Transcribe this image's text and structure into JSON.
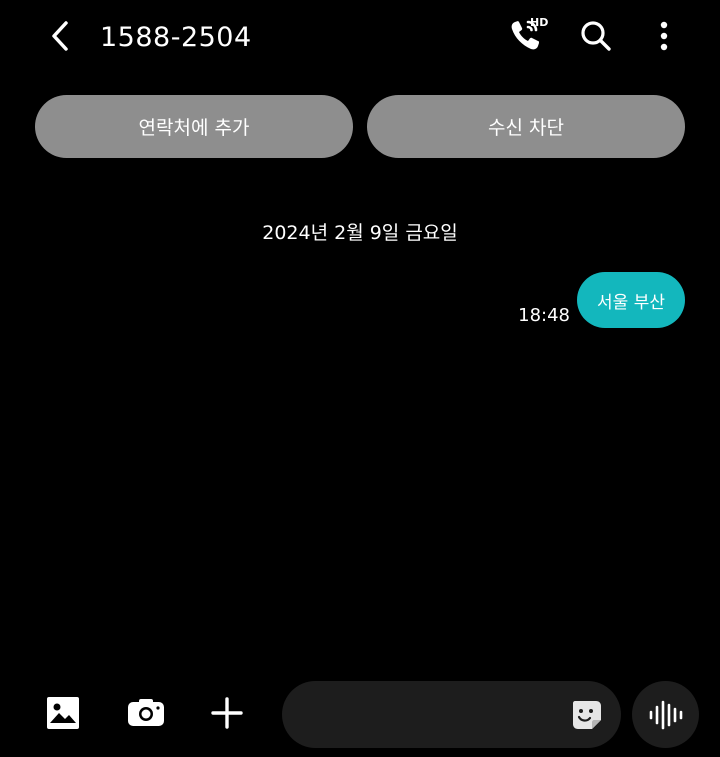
{
  "header": {
    "title": "1588-2504",
    "back_icon": "chevron-left-icon",
    "call_icon": "hd-call-icon",
    "call_badge": "HD",
    "search_icon": "search-icon",
    "more_icon": "more-vertical-icon"
  },
  "actions": {
    "add_contact": "연락처에 추가",
    "block_number": "수신 차단"
  },
  "conversation": {
    "date": "2024년 2월 9일 금요일",
    "messages": [
      {
        "text": "서울 부산",
        "time": "18:48",
        "direction": "outgoing"
      }
    ]
  },
  "composer": {
    "placeholder": "",
    "icons": [
      "gallery-icon",
      "camera-icon",
      "plus-icon",
      "sticker-icon",
      "voice-icon"
    ]
  },
  "colors": {
    "background": "#000000",
    "pill": "#8e8e8e",
    "bubble": "#13b7bd",
    "input": "#1d1d1d"
  }
}
